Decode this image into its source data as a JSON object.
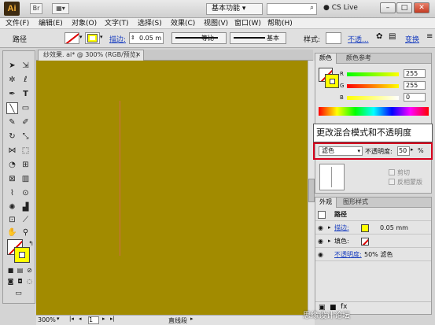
{
  "app": {
    "logo": "Ai",
    "workspace": "基本功能",
    "cs_live": "CS Live"
  },
  "menu": [
    "文件(F)",
    "编辑(E)",
    "对象(O)",
    "文字(T)",
    "选择(S)",
    "效果(C)",
    "视图(V)",
    "窗口(W)",
    "帮助(H)"
  ],
  "control_bar": {
    "object_type": "路径",
    "stroke_label": "描边:",
    "stroke_weight": "0.05 m",
    "profile": "等比",
    "brush": "基本",
    "style_label": "样式:",
    "opacity_label": "不透...",
    "colors": {
      "fill": "#ffff00",
      "stroke": "#cc0000"
    }
  },
  "document": {
    "tab_title": "纱效果. ai* @ 300% (RGB/预览)",
    "zoom": "300%",
    "page": "1",
    "status": "直线段",
    "canvas_color": "#a28b00",
    "path_color": "#d2694e"
  },
  "color_panel": {
    "tabs": [
      "颜色",
      "颜色参考"
    ],
    "channels": [
      {
        "label": "R",
        "value": "255"
      },
      {
        "label": "G",
        "value": "255"
      },
      {
        "label": "B",
        "value": "0"
      }
    ]
  },
  "tooltip": "更改混合模式和不透明度",
  "transparency": {
    "blend_mode": "滤色",
    "opacity_label": "不透明度:",
    "opacity_value": "50",
    "percent": "%",
    "clip": "剪切",
    "invert_mask": "反相蒙版"
  },
  "appearance": {
    "tabs": [
      "外观",
      "图形样式"
    ],
    "title": "路径",
    "stroke_label": "描边:",
    "stroke_value": "0.05 mm",
    "fill_label": "填色:",
    "opacity_label": "不透明度:",
    "opacity_value": "50% 滤色"
  },
  "watermark": "思缘设计论坛"
}
